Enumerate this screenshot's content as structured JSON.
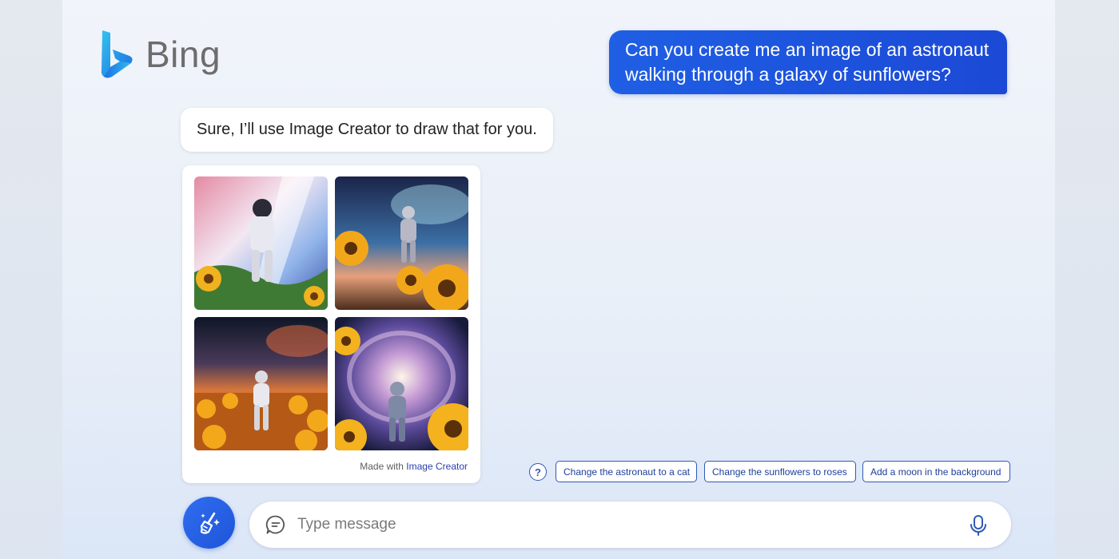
{
  "brand": {
    "name": "Bing"
  },
  "user_message": {
    "text": "Can you create me an image of an astronaut walking through a galaxy of sunflowers?"
  },
  "bot_message": {
    "text": "Sure, I’ll use Image Creator to draw that for you."
  },
  "image_card": {
    "thumbnails": [
      "astronaut-image-1",
      "astronaut-image-2",
      "astronaut-image-3",
      "astronaut-image-4"
    ],
    "made_with_prefix": "Made with",
    "made_with_link": "Image Creator"
  },
  "suggestions": {
    "help_glyph": "?",
    "chips": [
      "Change the astronaut to a cat",
      "Change the sunflowers to roses",
      "Add a moon in the background"
    ]
  },
  "input": {
    "placeholder": "Type message"
  },
  "icons": {
    "logo": "bing-logo-icon",
    "new_topic": "broom-sparkle-icon",
    "chat": "chat-bubble-icon",
    "mic": "microphone-icon"
  },
  "colors": {
    "accent": "#1f5fe4",
    "chip_border": "#2f58b6",
    "logo_text": "#6d6d6d"
  }
}
